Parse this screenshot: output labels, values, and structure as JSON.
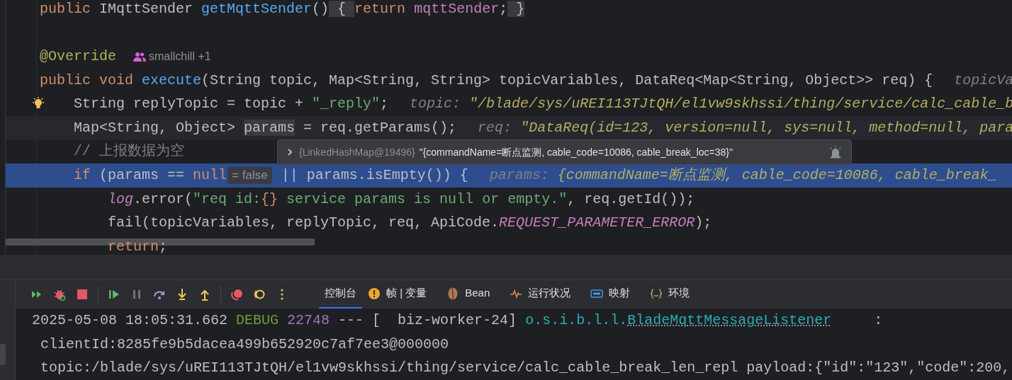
{
  "editor": {
    "lines": [
      {
        "current": false,
        "execution_point": false,
        "bulb": false,
        "tokens": [
          {
            "kind": "kw",
            "text": "public "
          },
          {
            "kind": "plain",
            "text": "IMqttSender "
          },
          {
            "kind": "method",
            "text": "getMqttSender"
          },
          {
            "kind": "plain",
            "text": "()"
          },
          {
            "kind": "fold",
            "text": " { "
          },
          {
            "kind": "kw",
            "text": "return "
          },
          {
            "kind": "field",
            "text": "mqttSender"
          },
          {
            "kind": "plain",
            "text": ";"
          },
          {
            "kind": "fold",
            "text": " }"
          }
        ]
      },
      {
        "current": false,
        "execution_point": false,
        "bulb": false
      },
      {
        "current": false,
        "execution_point": false,
        "bulb": false,
        "tokens": [
          {
            "kind": "annotation",
            "text": "@Override"
          },
          {
            "kind": "author",
            "text": "smallchill +1"
          }
        ]
      },
      {
        "current": false,
        "execution_point": false,
        "bulb": false,
        "tokens": [
          {
            "kind": "kw",
            "text": "public void "
          },
          {
            "kind": "method",
            "text": "execute"
          },
          {
            "kind": "plain",
            "text": "(String topic, Map<String, String> topicVariables, DataReq<Map<String, Object>> req) {"
          },
          {
            "kind": "hint_label",
            "text": "topicVa"
          }
        ]
      },
      {
        "current": false,
        "execution_point": false,
        "bulb": true,
        "tokens": [
          {
            "kind": "plain",
            "text": "    String replyTopic = topic + "
          },
          {
            "kind": "string",
            "text": "\"_reply\""
          },
          {
            "kind": "plain",
            "text": ";"
          },
          {
            "kind": "hint_label",
            "text": "topic: "
          },
          {
            "kind": "hint_value",
            "text": "\"/blade/sys/uREI113TJtQH/el1vw9skhssi/thing/service/calc_cable_b"
          }
        ]
      },
      {
        "current": true,
        "execution_point": false,
        "bulb": false,
        "tokens": [
          {
            "kind": "plain",
            "text": "    Map<String, Object> "
          },
          {
            "kind": "fold",
            "text": "params"
          },
          {
            "kind": "plain",
            "text": " = req.getParams();"
          },
          {
            "kind": "hint_label",
            "text": "req: "
          },
          {
            "kind": "hint_value",
            "text": "\"DataReq(id=123, version=null, sys=null, method=null, para"
          }
        ]
      },
      {
        "current": false,
        "execution_point": false,
        "bulb": false,
        "tokens": [
          {
            "kind": "comment",
            "text": "    // 上报数据为空"
          }
        ]
      },
      {
        "current": false,
        "execution_point": true,
        "bulb": false,
        "tokens": [
          {
            "kind": "kw",
            "text": "    if "
          },
          {
            "kind": "plain",
            "text": "(params == "
          },
          {
            "kind": "kw",
            "text": "null"
          },
          {
            "kind": "inline_value",
            "text": "= false"
          },
          {
            "kind": "plain",
            "text": " || params.isEmpty()) {"
          },
          {
            "kind": "hint_label",
            "text": "params: "
          },
          {
            "kind": "hint_value",
            "text": "{commandName=断点监测, cable_code=10086, cable_break_"
          }
        ]
      },
      {
        "current": false,
        "execution_point": false,
        "bulb": false,
        "tokens": [
          {
            "kind": "static",
            "text": "        log"
          },
          {
            "kind": "plain",
            "text": ".error("
          },
          {
            "kind": "string",
            "text": "\"req id:"
          },
          {
            "kind": "kw",
            "text": "{}"
          },
          {
            "kind": "string",
            "text": " service params is null or empty.\""
          },
          {
            "kind": "plain",
            "text": ", req.getId());"
          }
        ]
      },
      {
        "current": false,
        "execution_point": false,
        "bulb": false,
        "tokens": [
          {
            "kind": "plain",
            "text": "        fail(topicVariables, replyTopic, req, ApiCode."
          },
          {
            "kind": "static",
            "text": "REQUEST_PARAMETER_ERROR"
          },
          {
            "kind": "plain",
            "text": ");"
          }
        ]
      },
      {
        "current": false,
        "execution_point": false,
        "bulb": false,
        "tokens": [
          {
            "kind": "kw",
            "text": "        return"
          },
          {
            "kind": "plain",
            "text": ";"
          }
        ]
      }
    ]
  },
  "value_popup": {
    "expanded": false,
    "type_label": "{LinkedHashMap@19496}",
    "value": "\"{commandName=断点监测, cable_code=10086, cable_break_loc=38}\""
  },
  "debug_tabs": [
    {
      "label": "控制台",
      "selected": true
    },
    {
      "label": "帧 | 变量",
      "selected": false
    },
    {
      "label": "Bean",
      "selected": false
    },
    {
      "label": "运行状况",
      "selected": false
    },
    {
      "label": "映射",
      "selected": false
    },
    {
      "label": "环境",
      "selected": false
    }
  ],
  "console": {
    "lines": [
      [
        {
          "kind": "plain",
          "text": "2025-05-08 18:05:31.662 "
        },
        {
          "kind": "level",
          "text": "DEBUG"
        },
        {
          "kind": "pid",
          "text": " 22748"
        },
        {
          "kind": "plain",
          "text": " --- [  biz-worker-24] "
        },
        {
          "kind": "logger",
          "text": "o.s.i.b.l.l."
        },
        {
          "kind": "logger_link",
          "text": "BladeMqttMessageListener"
        },
        {
          "kind": "plain",
          "text": "     :"
        }
      ],
      [
        {
          "kind": "plain",
          "text": " clientId:8285fe9b5dacea499b652920c7af7ee3@000000"
        }
      ],
      [
        {
          "kind": "plain",
          "text": " topic:/blade/sys/uREI113TJtQH/el1vw9skhssi/thing/service/calc_cable_break_len_repl payload:{\"id\":\"123\",\"code\":200,"
        }
      ]
    ]
  }
}
